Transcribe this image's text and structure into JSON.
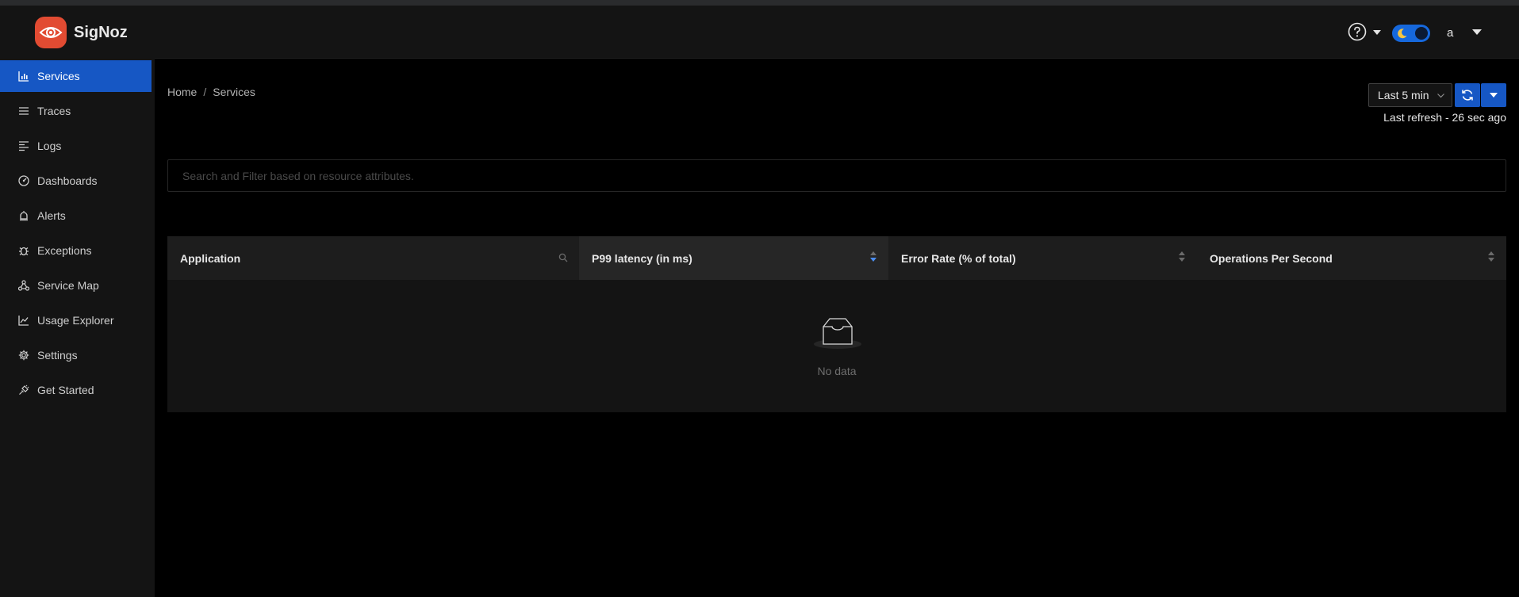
{
  "app": {
    "name": "SigNoz"
  },
  "header": {
    "user_name": "a"
  },
  "sidebar": {
    "items": [
      {
        "label": "Services",
        "icon": "bar-chart-icon",
        "active": true
      },
      {
        "label": "Traces",
        "icon": "menu-list-icon"
      },
      {
        "label": "Logs",
        "icon": "align-left-icon"
      },
      {
        "label": "Dashboards",
        "icon": "dashboard-icon"
      },
      {
        "label": "Alerts",
        "icon": "alert-bell-icon"
      },
      {
        "label": "Exceptions",
        "icon": "bug-icon"
      },
      {
        "label": "Service Map",
        "icon": "deployment-unit-icon"
      },
      {
        "label": "Usage Explorer",
        "icon": "line-chart-icon"
      },
      {
        "label": "Settings",
        "icon": "gear-icon"
      },
      {
        "label": "Get Started",
        "icon": "api-plug-icon"
      }
    ]
  },
  "breadcrumb": {
    "home": "Home",
    "separator": "/",
    "current": "Services"
  },
  "toolbar": {
    "time_range": "Last 5 min",
    "last_refresh": "Last refresh - 26 sec ago"
  },
  "search": {
    "placeholder": "Search and Filter based on resource attributes."
  },
  "table": {
    "columns": [
      "Application",
      "P99 latency (in ms)",
      "Error Rate (% of total)",
      "Operations Per Second"
    ],
    "sorted_column": "P99 latency (in ms)",
    "sort_direction": "descending",
    "rows": [],
    "empty_text": "No data"
  },
  "colors": {
    "accent": "#1657c4",
    "brand": "#e24b32",
    "background": "#000000",
    "panel": "#141414"
  }
}
